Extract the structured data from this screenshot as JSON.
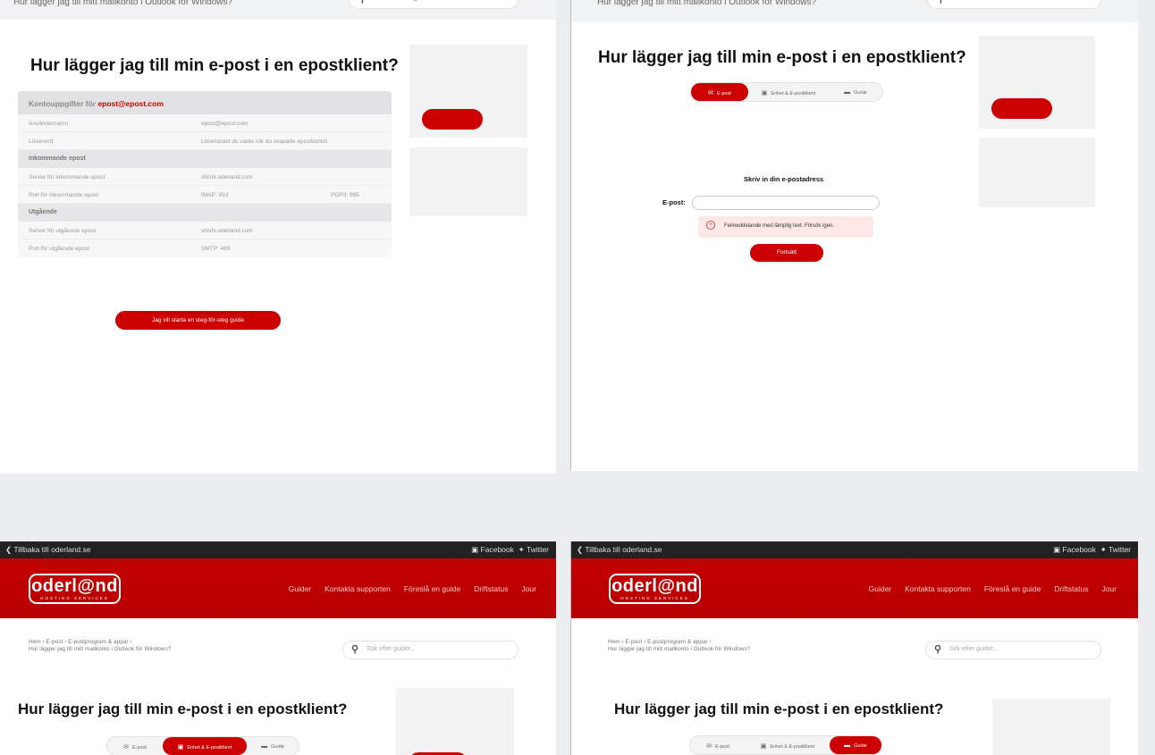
{
  "page_title": "Hur lägger jag till min e-post i en epostklient?",
  "breadcrumb": {
    "items": [
      "Hem",
      "E-post",
      "E-postprogram & appar"
    ],
    "current": "Hur lägger jag till mitt mailkonto i Outlook för Windows?"
  },
  "search": {
    "placeholder": "Sök efter guider..."
  },
  "topbar": {
    "back": "Tillbaka till oderland.se",
    "facebook": "Facebook",
    "twitter": "Twitter"
  },
  "logo": {
    "name": "oderl@nd",
    "tagline": "HOSTING SERVICES"
  },
  "nav": [
    "Guider",
    "Kontakta supporten",
    "Föreslå en guide",
    "Driftstatus",
    "Jour"
  ],
  "toggle": [
    "E-post",
    "Enhet & E-postklient",
    "Guide"
  ],
  "table": {
    "header_prefix": "Kontouppgifter för ",
    "header_email": "epost@epost.com",
    "account_rows": [
      {
        "k": "Användarnamn",
        "v": "epost@epost.com"
      },
      {
        "k": "Lösenord",
        "v": "Lösenordet du valde när du skapade epostkontot"
      }
    ],
    "incoming_title": "Inkommande epost",
    "incoming_rows": [
      {
        "k": "Server för inkommande epost",
        "v": "shishi.oderland.com"
      },
      {
        "k": "Port för inkommande epost",
        "v": "IMAP: 993",
        "v2": "POP3: 995"
      }
    ],
    "outgoing_title": "Utgående",
    "outgoing_rows": [
      {
        "k": "Server för utgående epost",
        "v": "shishi.oderland.com"
      },
      {
        "k": "Port för utgående epost",
        "v": "SMTP: 465"
      }
    ]
  },
  "guide_button": "Jag vill starta en steg-för-steg guide",
  "form": {
    "heading": "Skriv in din e-postadress",
    "label": "E-post:",
    "error": "Felmeddelande med lämplig text. Försök igen.",
    "submit": "Fortsätt"
  },
  "colors": {
    "brand_red": "#cc0000",
    "header_red": "#c00000"
  }
}
